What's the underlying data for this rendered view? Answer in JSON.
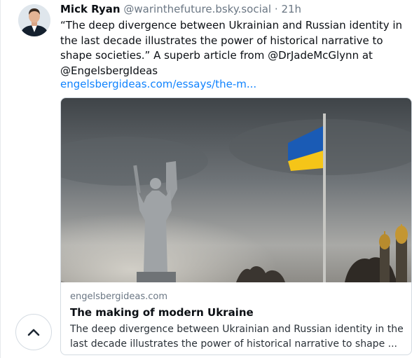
{
  "post": {
    "author_name": "Mick Ryan",
    "author_handle": "@warinthefuture.bsky.social",
    "separator": "·",
    "time": "21h",
    "text": "“The deep divergence between Ukrainian and Russian identity in the last decade illustrates the power of historical narrative to shape societies.” A superb article from @DrJadeMcGlynn at @EngelsbergIdeas",
    "link": "engelsbergideas.com/essays/the-m..."
  },
  "card": {
    "domain": "engelsbergideas.com",
    "title": "The making of modern Ukraine",
    "description": "The deep divergence between Ukrainian and Russian identity in the last decade illustrates the power of historical narrative to shape ..."
  },
  "controls": {
    "scroll_top_icon": "chevron-up-icon"
  },
  "colors": {
    "link": "#1083fe",
    "secondary_text": "#6b7784",
    "flag_blue": "#1a5bb5",
    "flag_yellow": "#f5c518"
  }
}
